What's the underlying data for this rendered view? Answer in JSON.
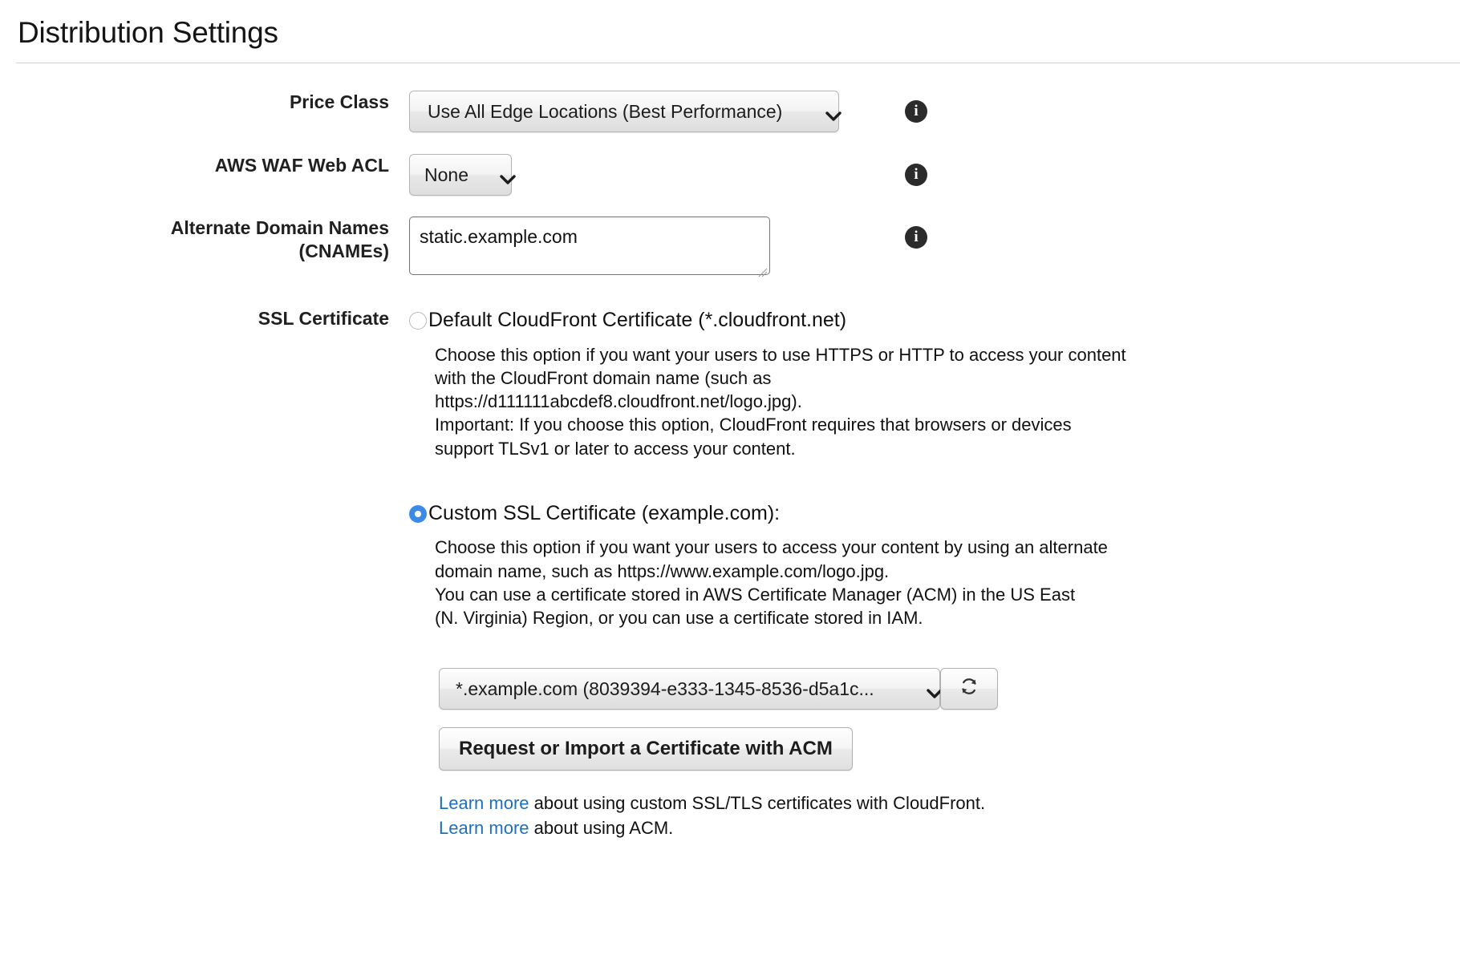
{
  "page": {
    "title": "Distribution Settings"
  },
  "price_class": {
    "label": "Price Class",
    "value": "Use All Edge Locations (Best Performance)",
    "info_glyph": "i"
  },
  "waf": {
    "label": "AWS WAF Web ACL",
    "value": "None",
    "info_glyph": "i"
  },
  "cnames": {
    "label_line1": "Alternate Domain Names",
    "label_line2": "(CNAMEs)",
    "value": "static.example.com",
    "placeholder": "",
    "info_glyph": "i"
  },
  "ssl": {
    "label": "SSL Certificate",
    "default_option": {
      "label": "Default CloudFront Certificate (*.cloudfront.net)",
      "selected": false,
      "description_lines": [
        "Choose this option if you want your users to use HTTPS or HTTP to access your content",
        "with the CloudFront domain name (such as",
        "https://d111111abcdef8.cloudfront.net/logo.jpg).",
        "Important: If you choose this option, CloudFront requires that browsers or devices",
        "support TLSv1 or later to access your content."
      ]
    },
    "custom_option": {
      "label": "Custom SSL Certificate (example.com):",
      "selected": true,
      "description_lines": [
        "Choose this option if you want your users to access your content by using an alternate",
        "domain name, such as https://www.example.com/logo.jpg.",
        "You can use a certificate stored in AWS Certificate Manager (ACM) in the US East",
        "(N. Virginia) Region, or you can use a certificate stored in IAM."
      ],
      "certificate_select_value": "*.example.com (8039394-e333-1345-8536-d5a1c...",
      "refresh_icon": "refresh-icon",
      "acm_button_label": "Request or Import a Certificate with ACM",
      "links": [
        {
          "link_text": "Learn more",
          "rest_text": " about using custom SSL/TLS certificates with CloudFront."
        },
        {
          "link_text": "Learn more",
          "rest_text": " about using ACM."
        }
      ]
    }
  },
  "colors": {
    "radio_selected": "#3b8ae8",
    "link": "#1f6fbf",
    "info_icon_bg": "#2b2b2b"
  }
}
